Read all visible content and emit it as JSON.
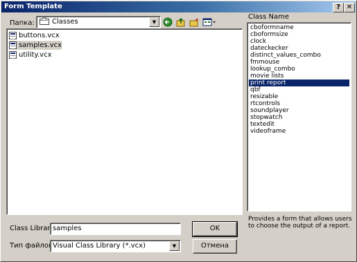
{
  "window": {
    "title": "Form Template",
    "help_btn": "?",
    "close_btn": "✕"
  },
  "lookin": {
    "label": "Папка:",
    "value": "Classes"
  },
  "files": [
    "buttons.vcx",
    "samples.vcx",
    "utility.vcx"
  ],
  "selected_file": "samples.vcx",
  "class_name": {
    "label": "Class Name",
    "items": [
      "cboformname",
      "cboformsize",
      "clock",
      "dateckecker",
      "distinct_values_combo",
      "fmmouse",
      "lookup_combo",
      "movie lists",
      "print report",
      "qbf",
      "resizable",
      "rtcontrols",
      "soundplayer",
      "stopwatch",
      "textedit",
      "videoframe"
    ],
    "selected": "print report"
  },
  "description": "Provides a form that allows users to choose the output of a report.",
  "class_library": {
    "label": "Class Library",
    "value": "samples"
  },
  "file_type": {
    "label": "Тип файлов:",
    "value": "Visual Class Library (*.vcx)"
  },
  "buttons": {
    "ok": "OK",
    "cancel": "Отмена"
  },
  "colors": {
    "selection": "#0a246a",
    "face": "#d4d0c8"
  }
}
